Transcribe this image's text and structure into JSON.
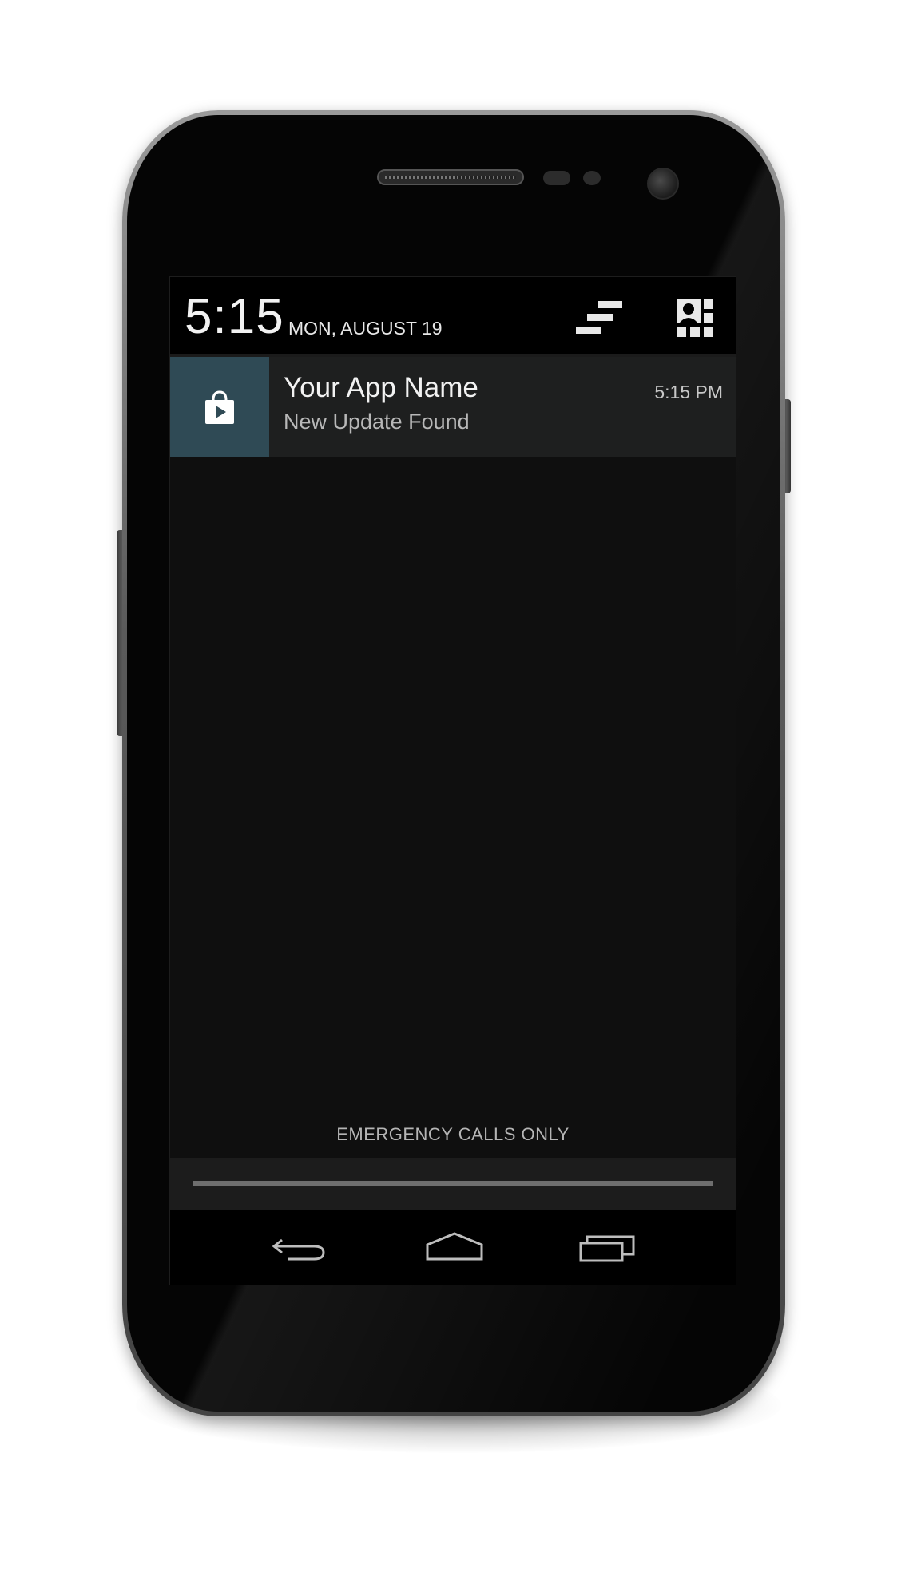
{
  "status_header": {
    "time": "5:15",
    "date": "MON, AUGUST 19",
    "clear_icon": "clear-notifications-icon",
    "settings_icon": "quick-settings-icon"
  },
  "notification": {
    "app_icon": "play-store-bag-icon",
    "title": "Your App Name",
    "text": "New Update Found",
    "time": "5:15 PM",
    "icon_bg_color": "#2f4a55"
  },
  "carrier_label": "EMERGENCY CALLS ONLY",
  "nav": {
    "back_icon": "back-icon",
    "home_icon": "home-icon",
    "recents_icon": "recents-icon"
  }
}
